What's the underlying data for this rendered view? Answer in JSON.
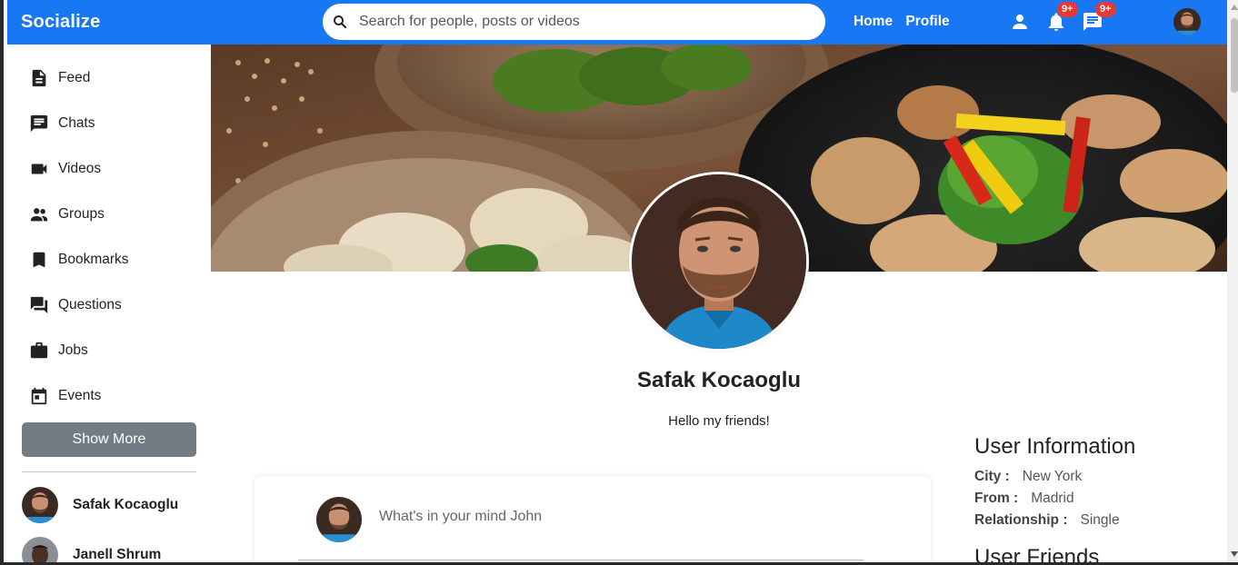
{
  "topbar": {
    "logo": "Socialize",
    "search_placeholder": "Search for people, posts or videos",
    "links": [
      "Home",
      "Profile"
    ],
    "notification_badge": "9+",
    "message_badge": "9+",
    "accent_color": "#1877f2"
  },
  "sidebar": {
    "items": [
      {
        "label": "Feed",
        "icon": "feed-icon"
      },
      {
        "label": "Chats",
        "icon": "chat-icon"
      },
      {
        "label": "Videos",
        "icon": "video-icon"
      },
      {
        "label": "Groups",
        "icon": "group-icon"
      },
      {
        "label": "Bookmarks",
        "icon": "bookmark-icon"
      },
      {
        "label": "Questions",
        "icon": "question-icon"
      },
      {
        "label": "Jobs",
        "icon": "work-icon"
      },
      {
        "label": "Events",
        "icon": "event-icon"
      }
    ],
    "show_more": "Show More",
    "friends": [
      "Safak Kocaoglu",
      "Janell Shrum"
    ]
  },
  "profile": {
    "name": "Safak Kocaoglu",
    "description": "Hello my friends!"
  },
  "share": {
    "placeholder": "What's in your mind John"
  },
  "user_info": {
    "title": "User Information",
    "rows": [
      {
        "key": "City :",
        "value": "New York"
      },
      {
        "key": "From :",
        "value": "Madrid"
      },
      {
        "key": "Relationship :",
        "value": "Single"
      }
    ],
    "friends_title": "User Friends"
  }
}
